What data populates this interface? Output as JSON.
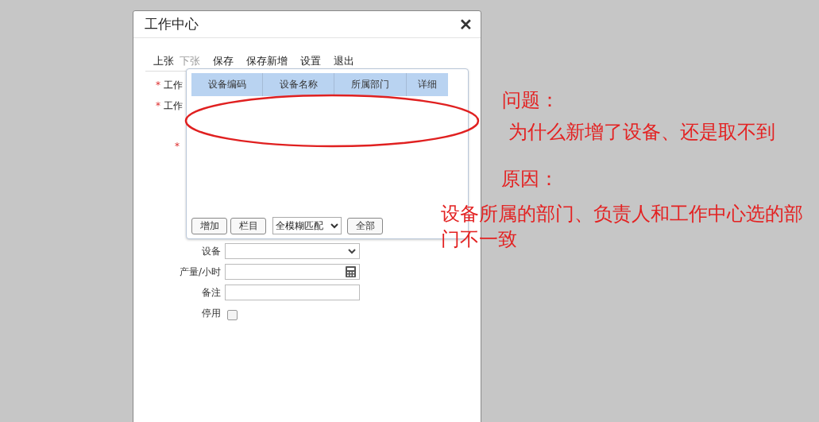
{
  "window": {
    "title": "工作中心",
    "close": "✕"
  },
  "toolbar": [
    {
      "label": "上张",
      "disabled": false
    },
    {
      "label": "下张",
      "disabled": true
    },
    {
      "label": "保存",
      "disabled": false
    },
    {
      "label": "保存新增",
      "disabled": false
    },
    {
      "label": "设置",
      "disabled": false
    },
    {
      "label": "退出",
      "disabled": false
    }
  ],
  "hidden_fields": [
    {
      "label": "工作",
      "required_mark": "*"
    },
    {
      "label": "工作",
      "required_mark": "*"
    },
    {
      "required_mark": "*"
    }
  ],
  "lookup_popup": {
    "columns": [
      "设备编码",
      "设备名称",
      "所属部门",
      "详细"
    ],
    "buttons": [
      "增加",
      "栏目"
    ],
    "match_mode": "全模糊匹配",
    "all_button": "全部"
  },
  "fields": [
    {
      "label": "设备",
      "kind": "select"
    },
    {
      "label": "产量/小时",
      "kind": "calculator"
    },
    {
      "label": "备注",
      "kind": "text"
    },
    {
      "label": "停用",
      "kind": "checkbox",
      "checked": false
    }
  ],
  "annotations": {
    "question_title": "问题：",
    "question": "为什么新增了设备、还是取不到",
    "reason_title": "原因：",
    "reason": "设备所属的部门、负责人和工作中心选的部门不一致"
  }
}
